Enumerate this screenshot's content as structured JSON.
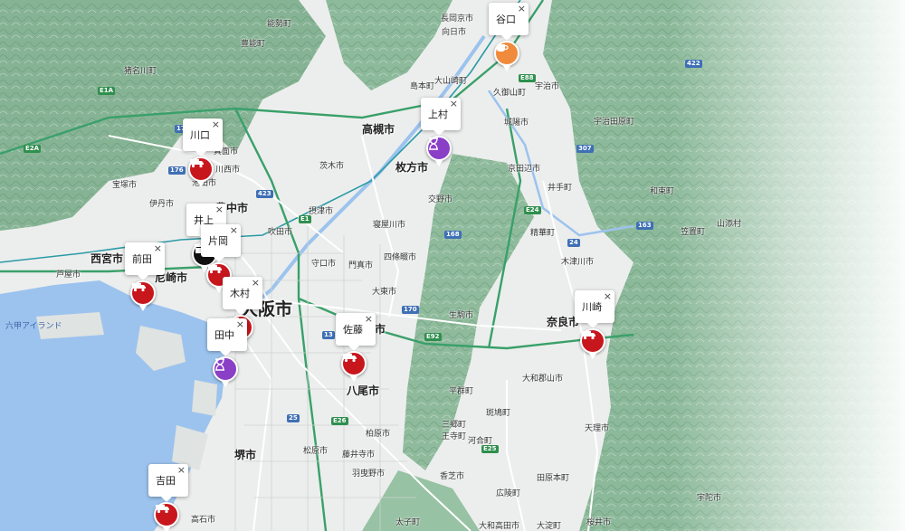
{
  "colors": {
    "water": "#9cc3ee",
    "land": "#eceeed",
    "mountain": "#7fae8c",
    "mountain_light": "#b9d1bd",
    "expressway": "#3aa06a",
    "red_marker": "#c8161d",
    "purple_marker": "#8a3fc7",
    "orange_marker": "#f08a3c",
    "black_marker": "#111111"
  },
  "cities": [
    {
      "id": "osaka",
      "label": "大阪市"
    },
    {
      "id": "takatsuki",
      "label": "高槻市"
    },
    {
      "id": "hirakata",
      "label": "枚方市"
    },
    {
      "id": "toyonaka",
      "label": "豊中市"
    },
    {
      "id": "nishinomiya",
      "label": "西宮市"
    },
    {
      "id": "amagasaki",
      "label": "尼崎市"
    },
    {
      "id": "yao",
      "label": "八尾市"
    },
    {
      "id": "nara",
      "label": "奈良市"
    },
    {
      "id": "sakai",
      "label": "堺市"
    },
    {
      "id": "higashiosaka",
      "label": "東大阪市"
    }
  ],
  "towns": [
    {
      "id": "mukou",
      "label": "向日市"
    },
    {
      "id": "nagaokakyo",
      "label": "長岡京市"
    },
    {
      "id": "oyamazaki",
      "label": "大山崎町"
    },
    {
      "id": "shimamoto",
      "label": "島本町"
    },
    {
      "id": "kumiyama",
      "label": "久御山町"
    },
    {
      "id": "uji",
      "label": "宇治市"
    },
    {
      "id": "ujitawara",
      "label": "宇治田原町"
    },
    {
      "id": "joyo",
      "label": "城陽市"
    },
    {
      "id": "kyotanabe",
      "label": "京田辺市"
    },
    {
      "id": "ide",
      "label": "井手町"
    },
    {
      "id": "wazuka",
      "label": "和束町"
    },
    {
      "id": "kasagi",
      "label": "笠置町"
    },
    {
      "id": "minoo",
      "label": "箕面市"
    },
    {
      "id": "ibaraki",
      "label": "茨木市"
    },
    {
      "id": "settsu",
      "label": "摂津市"
    },
    {
      "id": "suita",
      "label": "吹田市"
    },
    {
      "id": "neyagawa",
      "label": "寝屋川市"
    },
    {
      "id": "katano",
      "label": "交野市"
    },
    {
      "id": "shijonawate",
      "label": "四條畷市"
    },
    {
      "id": "daito",
      "label": "大東市"
    },
    {
      "id": "moriguchi",
      "label": "守口市"
    },
    {
      "id": "kadoma",
      "label": "門真市"
    },
    {
      "id": "ikoma",
      "label": "生駒市"
    },
    {
      "id": "seika",
      "label": "精華町"
    },
    {
      "id": "kizugawa",
      "label": "木津川市"
    },
    {
      "id": "ikeda",
      "label": "池田市"
    },
    {
      "id": "itami",
      "label": "伊丹市"
    },
    {
      "id": "kawanishi",
      "label": "川西市"
    },
    {
      "id": "takarazuka",
      "label": "宝塚市"
    },
    {
      "id": "inagawa",
      "label": "猪名川町"
    },
    {
      "id": "toyono",
      "label": "豊能町"
    },
    {
      "id": "nose",
      "label": "能勢町"
    },
    {
      "id": "ashiya",
      "label": "芦屋市"
    },
    {
      "id": "rokko",
      "label": "六甲アイランド"
    },
    {
      "id": "yamatokoriyama",
      "label": "大和郡山市"
    },
    {
      "id": "heguri",
      "label": "平群町"
    },
    {
      "id": "ikaruga",
      "label": "斑鳩町"
    },
    {
      "id": "sango",
      "label": "三郷町"
    },
    {
      "id": "oji",
      "label": "王寺町"
    },
    {
      "id": "kashiba",
      "label": "香芝市"
    },
    {
      "id": "kashihara",
      "label": "柏原市"
    },
    {
      "id": "fujiidera",
      "label": "藤井寺市"
    },
    {
      "id": "matsubara",
      "label": "松原市"
    },
    {
      "id": "habikino",
      "label": "羽曳野市"
    },
    {
      "id": "tenri",
      "label": "天理市"
    },
    {
      "id": "tawaramoto",
      "label": "田原本町"
    },
    {
      "id": "koryo",
      "label": "広陵町"
    },
    {
      "id": "yamatotakada",
      "label": "大和高田市"
    },
    {
      "id": "taishi",
      "label": "太子町"
    },
    {
      "id": "sakurai",
      "label": "桜井市"
    },
    {
      "id": "uda",
      "label": "宇陀市"
    },
    {
      "id": "yamazoe",
      "label": "山添村"
    },
    {
      "id": "takaishi",
      "label": "高石市"
    },
    {
      "id": "oyodo",
      "label": "大淀町"
    },
    {
      "id": "kawai",
      "label": "河合町"
    }
  ],
  "route_shields": [
    {
      "id": "e1",
      "label": "E1"
    },
    {
      "id": "e1a",
      "label": "E1A"
    },
    {
      "id": "e2a",
      "label": "E2A"
    },
    {
      "id": "e24",
      "label": "E24"
    },
    {
      "id": "e26",
      "label": "E26"
    },
    {
      "id": "e92",
      "label": "E92"
    },
    {
      "id": "e25",
      "label": "E25"
    },
    {
      "id": "e88",
      "label": "E88"
    },
    {
      "id": "r171",
      "label": "171"
    },
    {
      "id": "r176",
      "label": "176"
    },
    {
      "id": "r423",
      "label": "423"
    },
    {
      "id": "r170",
      "label": "170"
    },
    {
      "id": "r168",
      "label": "168"
    },
    {
      "id": "r163",
      "label": "163"
    },
    {
      "id": "r24",
      "label": "24"
    },
    {
      "id": "r25",
      "label": "25"
    },
    {
      "id": "r307",
      "label": "307"
    },
    {
      "id": "r422",
      "label": "422"
    },
    {
      "id": "r13",
      "label": "13"
    }
  ],
  "markers": [
    {
      "id": "taniguchi",
      "label": "谷口",
      "type": "cafe",
      "color": "#f08a3c",
      "icon": "coffee-icon"
    },
    {
      "id": "uemura",
      "label": "上村",
      "type": "hourglass",
      "color": "#8a3fc7",
      "icon": "hourglass-icon"
    },
    {
      "id": "kawaguchi",
      "label": "川口",
      "type": "truck",
      "color": "#c8161d",
      "icon": "truck-icon"
    },
    {
      "id": "inoue",
      "label": "井上",
      "type": "store",
      "color": "#111111",
      "icon": "store-icon"
    },
    {
      "id": "kataoka",
      "label": "片岡",
      "type": "truck",
      "color": "#c8161d",
      "icon": "truck-icon"
    },
    {
      "id": "maeda",
      "label": "前田",
      "type": "truck",
      "color": "#c8161d",
      "icon": "truck-icon"
    },
    {
      "id": "kimura",
      "label": "木村",
      "type": "truck",
      "color": "#c8161d",
      "icon": "truck-icon"
    },
    {
      "id": "tanaka",
      "label": "田中",
      "type": "hourglass",
      "color": "#8a3fc7",
      "icon": "hourglass-icon"
    },
    {
      "id": "sato",
      "label": "佐藤",
      "type": "truck",
      "color": "#c8161d",
      "icon": "truck-icon"
    },
    {
      "id": "kawasaki",
      "label": "川崎",
      "type": "truck",
      "color": "#c8161d",
      "icon": "truck-icon"
    },
    {
      "id": "yoshida",
      "label": "吉田",
      "type": "truck",
      "color": "#c8161d",
      "icon": "truck-icon"
    }
  ],
  "close_glyph": "×"
}
